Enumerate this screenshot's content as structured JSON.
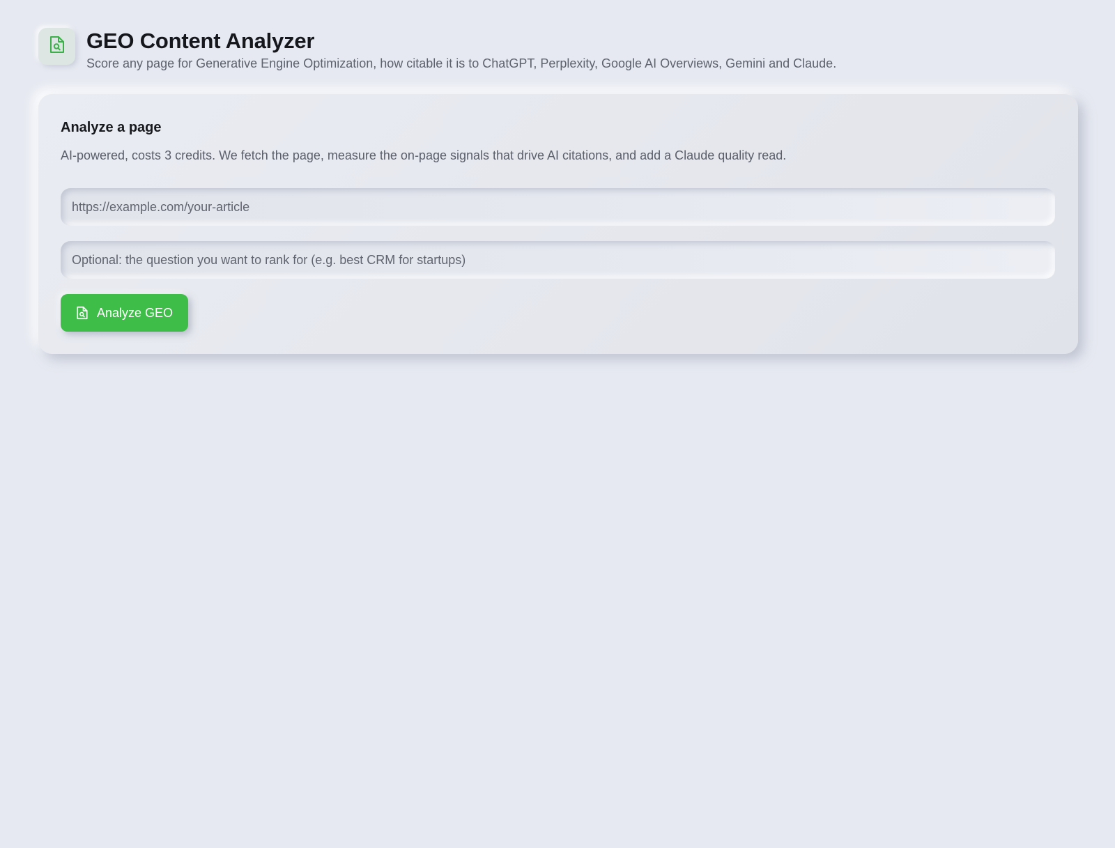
{
  "header": {
    "icon": "file-search-icon",
    "title": "GEO Content Analyzer",
    "subtitle": "Score any page for Generative Engine Optimization, how citable it is to ChatGPT, Perplexity, Google AI Overviews, Gemini and Claude."
  },
  "card": {
    "title": "Analyze a page",
    "description": "AI-powered, costs 3 credits. We fetch the page, measure the on-page signals that drive AI citations, and add a Claude quality read.",
    "url_input": {
      "value": "",
      "placeholder": "https://example.com/your-article"
    },
    "question_input": {
      "value": "",
      "placeholder": "Optional: the question you want to rank for (e.g. best CRM for startups)"
    },
    "analyze_button": {
      "label": "Analyze GEO",
      "icon": "file-search-icon"
    }
  },
  "colors": {
    "background": "#e6e9f1",
    "accent": "#3ebd48",
    "icon_accent": "#3cb048"
  }
}
